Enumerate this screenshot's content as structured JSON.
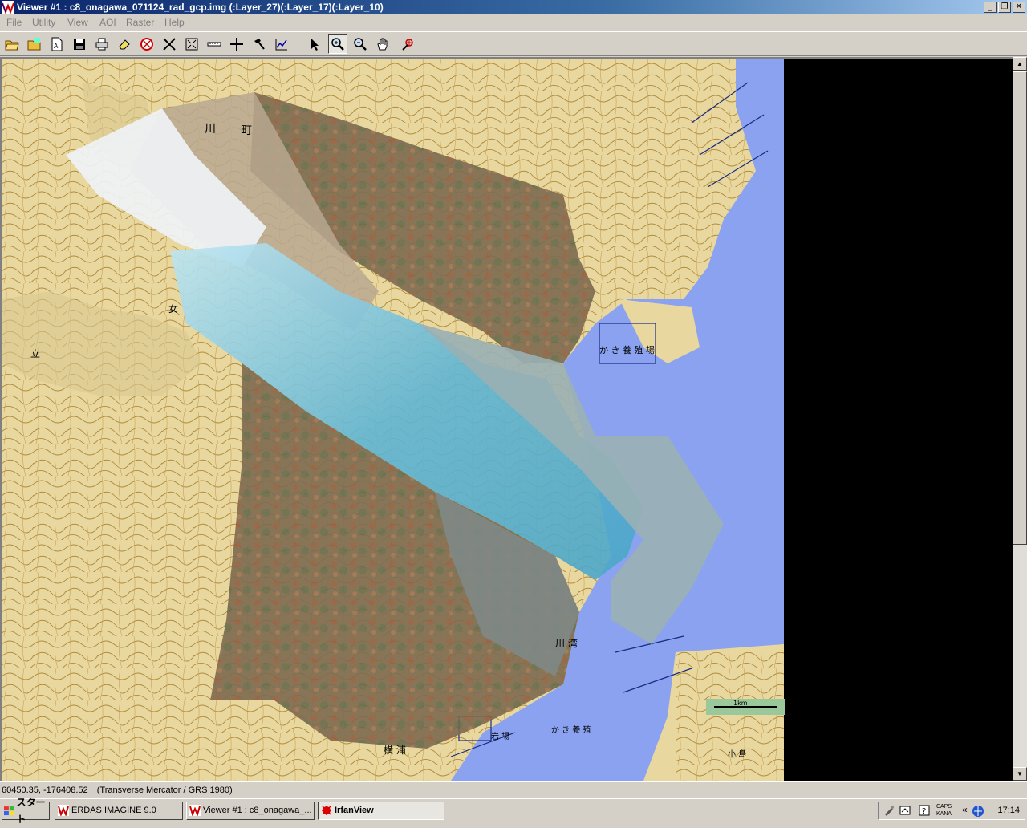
{
  "window": {
    "title": "Viewer #1 : c8_onagawa_071124_rad_gcp.img (:Layer_27)(:Layer_17)(:Layer_10)",
    "min_glyph": "_",
    "max_glyph": "❐",
    "close_glyph": "✕"
  },
  "menu": [
    {
      "label": "File"
    },
    {
      "label": "Utility"
    },
    {
      "label": "View"
    },
    {
      "label": "AOI"
    },
    {
      "label": "Raster"
    },
    {
      "label": "Help"
    }
  ],
  "toolbar": [
    {
      "icon": "open-folder-icon"
    },
    {
      "icon": "open-layer-icon"
    },
    {
      "icon": "new-doc-icon"
    },
    {
      "icon": "save-icon"
    },
    {
      "icon": "print-icon"
    },
    {
      "icon": "eraser-icon"
    },
    {
      "icon": "color-wheel-icon"
    },
    {
      "icon": "zoom-center-icon"
    },
    {
      "icon": "fit-window-icon"
    },
    {
      "icon": "measure-icon"
    },
    {
      "icon": "crosshair-icon"
    },
    {
      "icon": "hammer-icon"
    },
    {
      "icon": "profile-icon"
    },
    {
      "icon": "pointer-icon"
    },
    {
      "icon": "zoom-in-icon"
    },
    {
      "icon": "zoom-out-icon"
    },
    {
      "icon": "pan-hand-icon"
    },
    {
      "icon": "inquire-icon"
    }
  ],
  "map": {
    "labels": {
      "top_kawa": "川",
      "top_cho": "町",
      "bay_label": "か き 養 殖 場",
      "bay_south": "川 湾",
      "left_a": "女",
      "left_b": "立",
      "south_a": "横 浦",
      "south_b": "か き 養 殖",
      "south_c": "岩 場",
      "se_label": "小 島",
      "scale_label": "1km"
    },
    "colors": {
      "land": "#e6d49a",
      "sea": "#8aa2f0",
      "contour": "#a07a30",
      "photo_forest": "#7a6a52",
      "photo_water": "#6fb8d0"
    }
  },
  "status": {
    "coords": "60450.35, -176408.52",
    "projection": "(Transverse Mercator / GRS 1980)"
  },
  "taskbar": {
    "start": "スタート",
    "tasks": [
      {
        "label": "ERDAS IMAGINE 9.0"
      },
      {
        "label": "Viewer #1 : c8_onagawa_..."
      },
      {
        "label": "IrfanView"
      }
    ],
    "tray_caps": "CAPS",
    "tray_kana": "KANA",
    "clock": "17:14"
  }
}
